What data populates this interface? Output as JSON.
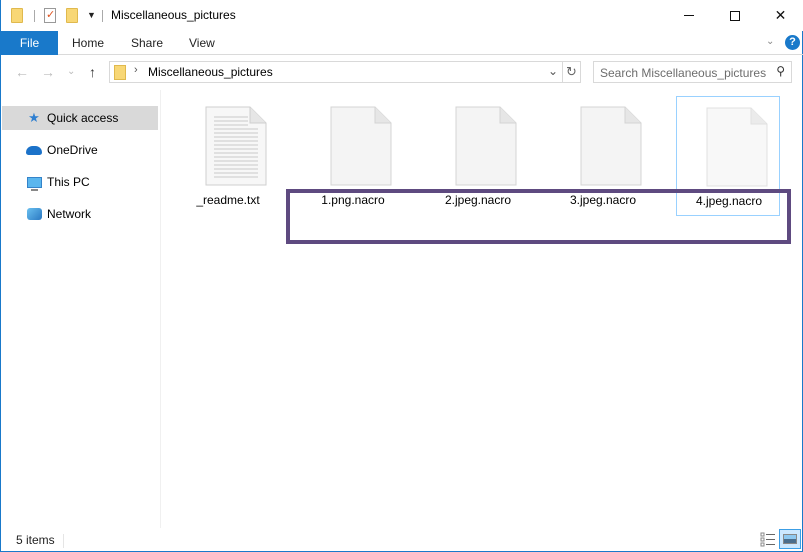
{
  "window": {
    "title": "Miscellaneous_pictures",
    "controls": {
      "minimize": "minimize",
      "maximize": "maximize",
      "close": "✕"
    }
  },
  "ribbon": {
    "tabs": [
      {
        "label": "File",
        "active": true
      },
      {
        "label": "Home"
      },
      {
        "label": "Share"
      },
      {
        "label": "View"
      }
    ],
    "expand_glyph": "⌄",
    "help_glyph": "?",
    "accent_color": "#1979ca"
  },
  "navigation": {
    "back_glyph": "←",
    "forward_glyph": "→",
    "recent_glyph": "⌄",
    "up_glyph": "↑",
    "address": {
      "chevron": "›",
      "path": "Miscellaneous_pictures",
      "dropdown_glyph": "⌄",
      "refresh_glyph": "↻"
    },
    "search": {
      "placeholder": "Search Miscellaneous_pictures",
      "icon_glyph": "⚲"
    }
  },
  "sidebar": {
    "items": [
      {
        "label": "Quick access",
        "icon": "star-icon",
        "glyph": "★",
        "selected": true
      },
      {
        "label": "OneDrive",
        "icon": "cloud-icon"
      },
      {
        "label": "This PC",
        "icon": "computer-icon"
      },
      {
        "label": "Network",
        "icon": "network-icon"
      }
    ]
  },
  "files": [
    {
      "name": "_readme.txt",
      "type": "text-document"
    },
    {
      "name": "1.png.nacro",
      "type": "blank-document"
    },
    {
      "name": "2.jpeg.nacro",
      "type": "blank-document"
    },
    {
      "name": "3.jpeg.nacro",
      "type": "blank-document"
    },
    {
      "name": "4.jpeg.nacro",
      "type": "blank-document",
      "focused": true
    }
  ],
  "annotation": {
    "highlight_color": "#5e4a80",
    "description": "encrypted files highlighted"
  },
  "statusbar": {
    "item_count": "5 items"
  }
}
